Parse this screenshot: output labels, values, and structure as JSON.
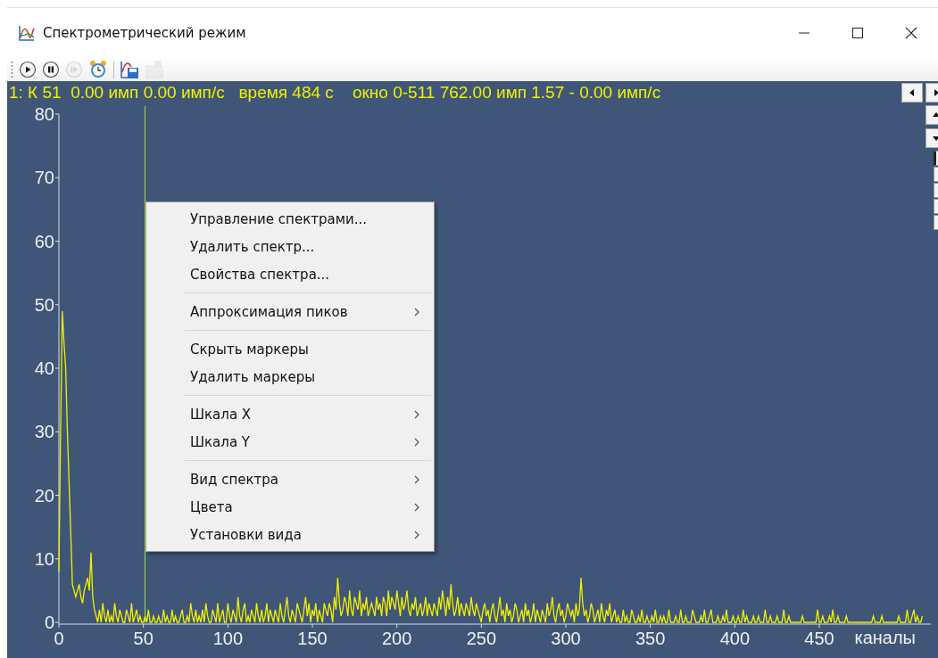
{
  "window": {
    "title": "Спектрометрический режим"
  },
  "toolbar": [
    {
      "kind": "play",
      "disabled": false
    },
    {
      "kind": "pause",
      "disabled": false
    },
    {
      "kind": "step",
      "disabled": true
    },
    {
      "kind": "clock",
      "disabled": false
    },
    {
      "kind": "separator"
    },
    {
      "kind": "save",
      "disabled": false
    },
    {
      "kind": "export",
      "disabled": true
    }
  ],
  "info_line": "1: К 51  0.00 имп 0.00 имп/с   время 484 с    окно 0-511 762.00 имп 1.57 - 0.00 имп/с",
  "side_boxes": [
    {
      "checked": true
    },
    {
      "checked": false
    },
    {
      "checked": false
    },
    {
      "checked": false
    },
    {
      "checked": false
    }
  ],
  "plot": {
    "x_tick_labels": [
      "0",
      "50",
      "100",
      "150",
      "200",
      "250",
      "300",
      "350",
      "400",
      "450"
    ],
    "chart_data": {
      "type": "line",
      "xlabel": "каналы",
      "ylim": [
        0,
        80
      ],
      "yticks": [
        0,
        10,
        20,
        30,
        40,
        50,
        60,
        70,
        80
      ],
      "series": [
        {
          "color": "#f0f000",
          "values": [
            8,
            30,
            49,
            44,
            40,
            30,
            22,
            14,
            6,
            5,
            4,
            5,
            6,
            4,
            3,
            5,
            6,
            7,
            5,
            11,
            4,
            2,
            1,
            0,
            2,
            0,
            3,
            1,
            0,
            2,
            0,
            1,
            0,
            3,
            1,
            0,
            2,
            1,
            0,
            0,
            2,
            1,
            0,
            3,
            0,
            1,
            2,
            0,
            1,
            0,
            0,
            1,
            0,
            2,
            0,
            0,
            1,
            0,
            0,
            1,
            0,
            0,
            2,
            0,
            1,
            0,
            0,
            2,
            0,
            1,
            0,
            0,
            1,
            2,
            0,
            0,
            1,
            0,
            3,
            1,
            0,
            2,
            0,
            1,
            0,
            2,
            0,
            3,
            1,
            0,
            0,
            2,
            1,
            0,
            3,
            0,
            1,
            2,
            0,
            0,
            3,
            1,
            0,
            2,
            1,
            0,
            4,
            1,
            0,
            2,
            3,
            0,
            1,
            0,
            2,
            1,
            0,
            3,
            1,
            0,
            2,
            0,
            1,
            3,
            0,
            2,
            1,
            0,
            2,
            1,
            0,
            3,
            1,
            0,
            2,
            4,
            1,
            0,
            2,
            1,
            0,
            3,
            2,
            1,
            0,
            2,
            4,
            1,
            3,
            0,
            2,
            1,
            3,
            0,
            2,
            1,
            0,
            3,
            2,
            1,
            3,
            2,
            0,
            4,
            2,
            7,
            3,
            1,
            2,
            4,
            3,
            1,
            5,
            2,
            1,
            4,
            3,
            2,
            5,
            1,
            3,
            2,
            4,
            1,
            2,
            3,
            2,
            1,
            4,
            2,
            3,
            1,
            4,
            3,
            1,
            5,
            2,
            4,
            3,
            2,
            5,
            3,
            1,
            4,
            2,
            3,
            5,
            2,
            1,
            3,
            2,
            4,
            1,
            2,
            3,
            1,
            2,
            4,
            1,
            3,
            2,
            1,
            3,
            2,
            1,
            4,
            2,
            5,
            3,
            1,
            4,
            2,
            6,
            3,
            1,
            2,
            4,
            1,
            3,
            2,
            1,
            3,
            2,
            1,
            4,
            2,
            1,
            3,
            2,
            1,
            0,
            2,
            3,
            1,
            2,
            0,
            2,
            3,
            1,
            0,
            2,
            4,
            1,
            2,
            0,
            3,
            1,
            2,
            0,
            1,
            3,
            2,
            0,
            1,
            2,
            0,
            3,
            1,
            2,
            0,
            1,
            3,
            0,
            2,
            1,
            0,
            2,
            1,
            0,
            3,
            1,
            2,
            4,
            1,
            0,
            2,
            3,
            1,
            2,
            0,
            1,
            3,
            2,
            1,
            2,
            0,
            3,
            1,
            2,
            7,
            3,
            1,
            2,
            0,
            1,
            3,
            2,
            0,
            1,
            2,
            0,
            3,
            1,
            0,
            2,
            1,
            3,
            0,
            1,
            2,
            0,
            1,
            0,
            0,
            2,
            0,
            1,
            0,
            0,
            2,
            1,
            0,
            0,
            1,
            0,
            2,
            0,
            0,
            1,
            0,
            0,
            1,
            0,
            2,
            0,
            0,
            1,
            0,
            1,
            0,
            0,
            2,
            0,
            0,
            0,
            1,
            0,
            0,
            2,
            0,
            0,
            1,
            0,
            0,
            0,
            2,
            1,
            0,
            0,
            0,
            1,
            0,
            2,
            0,
            0,
            1,
            2,
            0,
            0,
            0,
            1,
            0,
            0,
            1,
            0,
            2,
            0,
            0,
            0,
            1,
            0,
            0,
            1,
            0,
            0,
            2,
            0,
            1,
            0,
            0,
            0,
            1,
            0,
            0,
            1,
            0,
            0,
            0,
            2,
            0,
            0,
            1,
            0,
            0,
            0,
            1,
            0,
            0,
            0,
            2,
            0,
            0,
            1,
            0,
            0,
            0,
            0,
            0,
            0,
            0,
            1,
            0,
            0,
            0,
            0,
            0,
            0,
            0,
            0,
            2,
            0,
            0,
            1,
            0,
            0,
            0,
            1,
            0,
            2,
            0,
            0,
            1,
            0,
            0,
            0,
            0,
            1,
            0,
            0,
            0,
            0,
            0,
            0,
            0,
            0,
            0,
            0,
            0,
            0,
            0,
            0,
            0,
            1,
            0,
            0,
            0,
            0,
            1,
            0,
            0,
            0,
            0,
            0,
            0,
            0,
            0,
            0,
            1,
            0,
            0,
            0,
            0,
            2,
            0,
            0,
            1,
            2,
            0,
            1,
            0,
            0,
            1
          ]
        }
      ]
    }
  },
  "context_menu": [
    {
      "kind": "item",
      "label": "Управление спектрами...",
      "has_submenu": false
    },
    {
      "kind": "item",
      "label": "Удалить спектр...",
      "has_submenu": false
    },
    {
      "kind": "item",
      "label": "Свойства спектра...",
      "has_submenu": false
    },
    {
      "kind": "separator"
    },
    {
      "kind": "item",
      "label": "Аппроксимация пиков",
      "has_submenu": true
    },
    {
      "kind": "separator"
    },
    {
      "kind": "item",
      "label": "Скрыть маркеры",
      "has_submenu": false
    },
    {
      "kind": "item",
      "label": "Удалить маркеры",
      "has_submenu": false
    },
    {
      "kind": "separator"
    },
    {
      "kind": "item",
      "label": "Шкала X",
      "has_submenu": true
    },
    {
      "kind": "item",
      "label": "Шкала Y",
      "has_submenu": true
    },
    {
      "kind": "separator"
    },
    {
      "kind": "item",
      "label": "Вид спектра",
      "has_submenu": true
    },
    {
      "kind": "item",
      "label": "Цвета",
      "has_submenu": true
    },
    {
      "kind": "item",
      "label": "Установки вида",
      "has_submenu": true
    }
  ]
}
